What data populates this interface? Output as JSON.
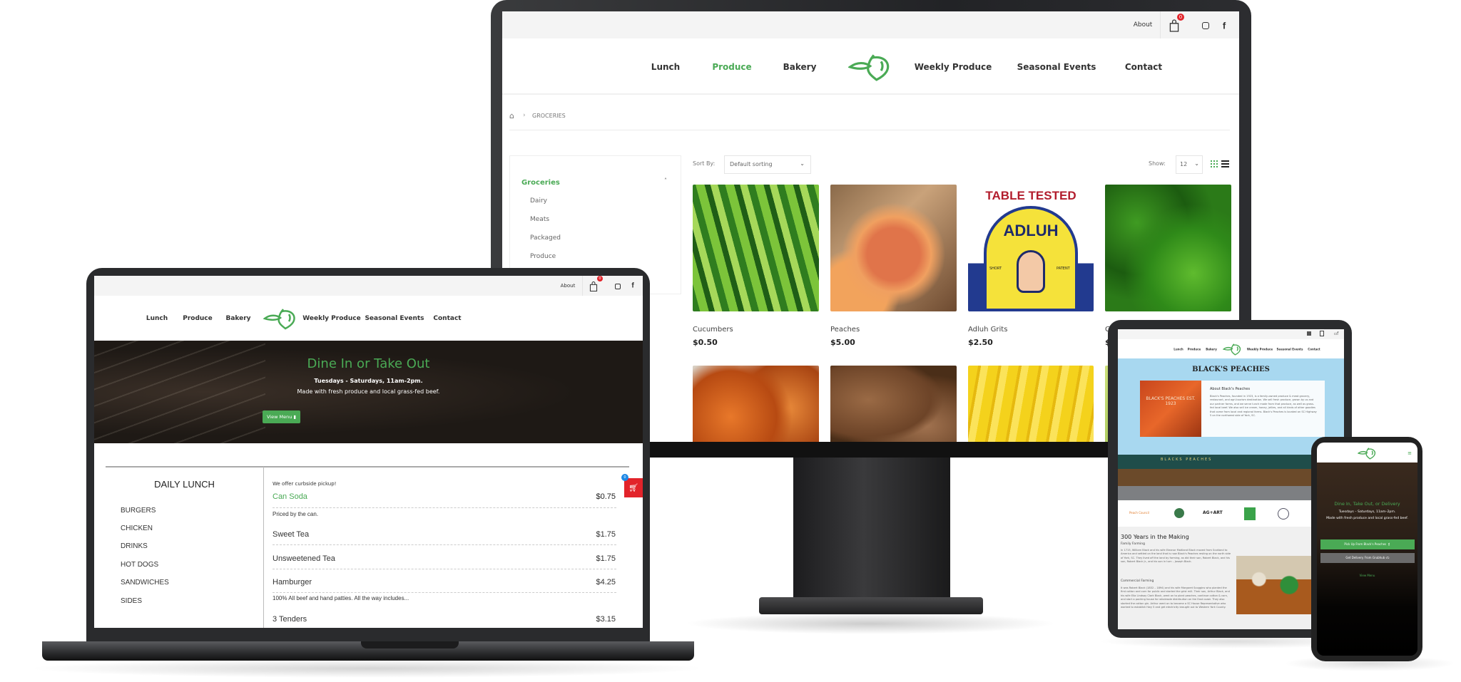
{
  "colors": {
    "brand_green": "#4aaa55",
    "cart_red": "#e2232a",
    "badge_blue": "#1e88e5",
    "tablet_blue": "#a8d8f0"
  },
  "nav": {
    "items": [
      "Lunch",
      "Produce",
      "Bakery",
      "Weekly Produce",
      "Seasonal Events",
      "Contact"
    ],
    "active": "Produce",
    "about": "About",
    "cart_count": "0"
  },
  "monitor": {
    "breadcrumb": "GROCERIES",
    "sidebar": {
      "category": "Groceries",
      "items": [
        "Dairy",
        "Meats",
        "Packaged",
        "Produce"
      ]
    },
    "sort_label": "Sort By:",
    "sort_value": "Default sorting",
    "show_label": "Show:",
    "show_value": "12",
    "products": [
      {
        "name": "Cucumbers",
        "price": "$0.50"
      },
      {
        "name": "Peaches",
        "price": "$5.00"
      },
      {
        "name": "Adluh Grits",
        "price": "$2.50"
      },
      {
        "name": "G",
        "price": "$"
      }
    ],
    "adluh_label": {
      "top": "TABLE TESTED",
      "brand": "ADLUH",
      "left": "SHORT",
      "right": "PATENT"
    }
  },
  "laptop": {
    "hero": {
      "title": "Dine In or Take Out",
      "hours": "Tuesdays - Saturdays, 11am-2pm.",
      "subtitle": "Made with fresh produce and local grass-fed beef.",
      "button": "View Menu"
    },
    "menu_heading": "DAILY LUNCH",
    "categories": [
      "BURGERS",
      "CHICKEN",
      "DRINKS",
      "HOT DOGS",
      "SANDWICHES",
      "SIDES"
    ],
    "notice": "We offer curbside pickup!",
    "items": [
      {
        "name": "Can Soda",
        "price": "$0.75",
        "desc": "Priced by the can."
      },
      {
        "name": "Sweet Tea",
        "price": "$1.75",
        "desc": ""
      },
      {
        "name": "Unsweetened Tea",
        "price": "$1.75",
        "desc": ""
      },
      {
        "name": "Hamburger",
        "price": "$4.25",
        "desc": "100% All beef and hand patties. All the way includes..."
      },
      {
        "name": "3 Tenders",
        "price": "$3.15",
        "desc": ""
      }
    ],
    "floating_cart_count": "0"
  },
  "tablet": {
    "title": "BLACK'S PEACHES",
    "about_title": "About Black's Peaches",
    "about_text": "Black's Peaches, founded in 1923, is a family-owned produce & meat grocery, restaurant, and agri-tourism destination. We sell fresh produce, grown by us and our partner farms, and we serve lunch made from that produce, as well as grass-fed local beef. We also sell ice cream, honey, jellies, and all kinds of other goodies that come from local and regional farms. Black's Peaches is located on SC Highway 5 on the northwest side of York, SC.",
    "sign_text": "BLACK'S PEACHES EST. 1923",
    "building_sign": "BLACKS PEACHES",
    "partner_logos": [
      "Peach Council",
      "SC seal",
      "AG+ART",
      "Farm Bureau",
      "Certified",
      "AG"
    ],
    "history_title": "300 Years in the Making",
    "family_title": "Family Farming",
    "family_text": "In 1715, William Black and his wife Eleanor Maitland Black moved from Scotland to America and settled on the land that is now Black's Peaches resting on the north side of York, SC. They lived off the land by farming, as did their son, Robert Black, and his son, Robert Black Jr., and his son in turn – Joseph Black.",
    "commercial_title": "Commercial Farming",
    "commercial_text": "It was Robert Black (1832 – 1894) and his wife Margaret Scoggins who planted the first cotton and corn for public and started the grist mill. Their son, Arthur Black, and his wife Ella Lindsay Clark Black, went on to plant peaches, continue cotton & corn, and start a packing house for wholesale distribution on the East coast. They also started the cotton gin. Arthur went on to become a SC House Representative who worked to establish Hwy 5 and get electricity brought out to Western York County."
  },
  "phone": {
    "title": "Dine In, Take Out, or Delivery",
    "hours": "Tuesdays – Saturdays, 11am–2pm.",
    "subtitle": "Made with fresh produce and local grass-fed beef.",
    "pickup_button": "Pick Up From Black's Peaches",
    "delivery_button": "Get Delivery From Grubhub",
    "view_menu": "View Menu"
  }
}
